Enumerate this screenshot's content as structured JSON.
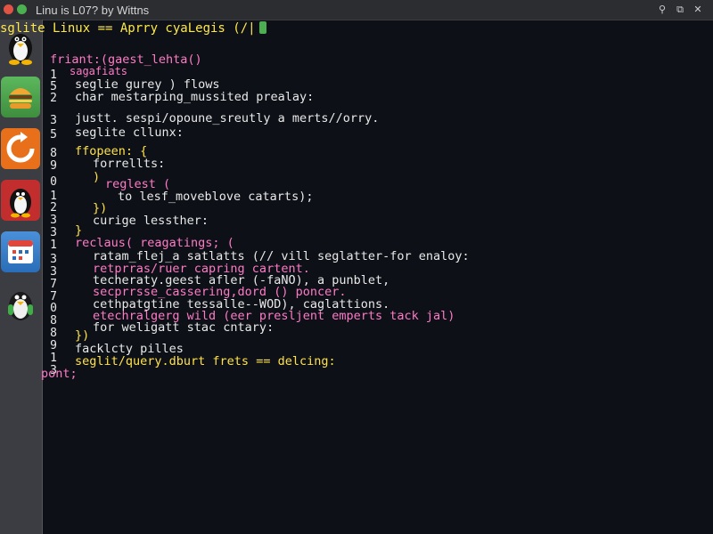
{
  "window": {
    "title": "Linu is L07? by Wittns",
    "buttons": [
      "search-icon",
      "restore-icon",
      "close-icon"
    ]
  },
  "dock": {
    "apps": [
      "penguin-icon",
      "burger-icon",
      "refresh-icon",
      "penguin-red-icon",
      "calendar-icon",
      "penguin-green-icon"
    ]
  },
  "terminal": {
    "prompt": "sglite Linux == Aprry cyaLegis (/|",
    "lines": [
      {
        "n": "",
        "text": "friant:(gaest_lehta()"
      },
      {
        "n": "1",
        "text": "sagafiats"
      },
      {
        "n": "5",
        "text": "seglie gurey ) flows"
      },
      {
        "n": "2",
        "text": "char mestarping_mussited prealay:"
      },
      {
        "n": "3",
        "text": "justt. sespi/opoune_sreutly a merts//orry."
      },
      {
        "n": "5",
        "text": "seglite cllunx:"
      },
      {
        "n": "8",
        "text": "ffopeen: {"
      },
      {
        "n": "9",
        "text": "forrellts:"
      },
      {
        "n": "0",
        "text": ")"
      },
      {
        "n": "1",
        "text": "reglest ("
      },
      {
        "n": "2",
        "text": "to lesf_moveblove catarts);"
      },
      {
        "n": "3",
        "text": "})"
      },
      {
        "n": "3",
        "text": "curige lessther:"
      },
      {
        "n": "1",
        "text": "}"
      },
      {
        "n": "3",
        "text": "reclaus( reagatings; ("
      },
      {
        "n": "3",
        "text": "ratam_flej_a satlatts (// vill seglatter-for enaloy:"
      },
      {
        "n": "7",
        "text": "retprras/ruer capring cartent."
      },
      {
        "n": "7",
        "text": "techeraty.geest afler (-faNO), a punblet,"
      },
      {
        "n": "0",
        "text": "secprrsse_cassering,dord () poncer."
      },
      {
        "n": "8",
        "text": "cethpatgtine tessalle--WOD), caglattions."
      },
      {
        "n": "8",
        "text": "etechralgerg wild (eer presljent emperts tack jal)"
      },
      {
        "n": "9",
        "text": "for weligatt stac cntary:"
      },
      {
        "n": "1",
        "text": "})"
      },
      {
        "n": "3",
        "text": "facklcty pilles"
      },
      {
        "n": "3",
        "text": "seglit/query.dburt frets == delcing:"
      },
      {
        "n": "",
        "text": "pont;"
      }
    ]
  }
}
